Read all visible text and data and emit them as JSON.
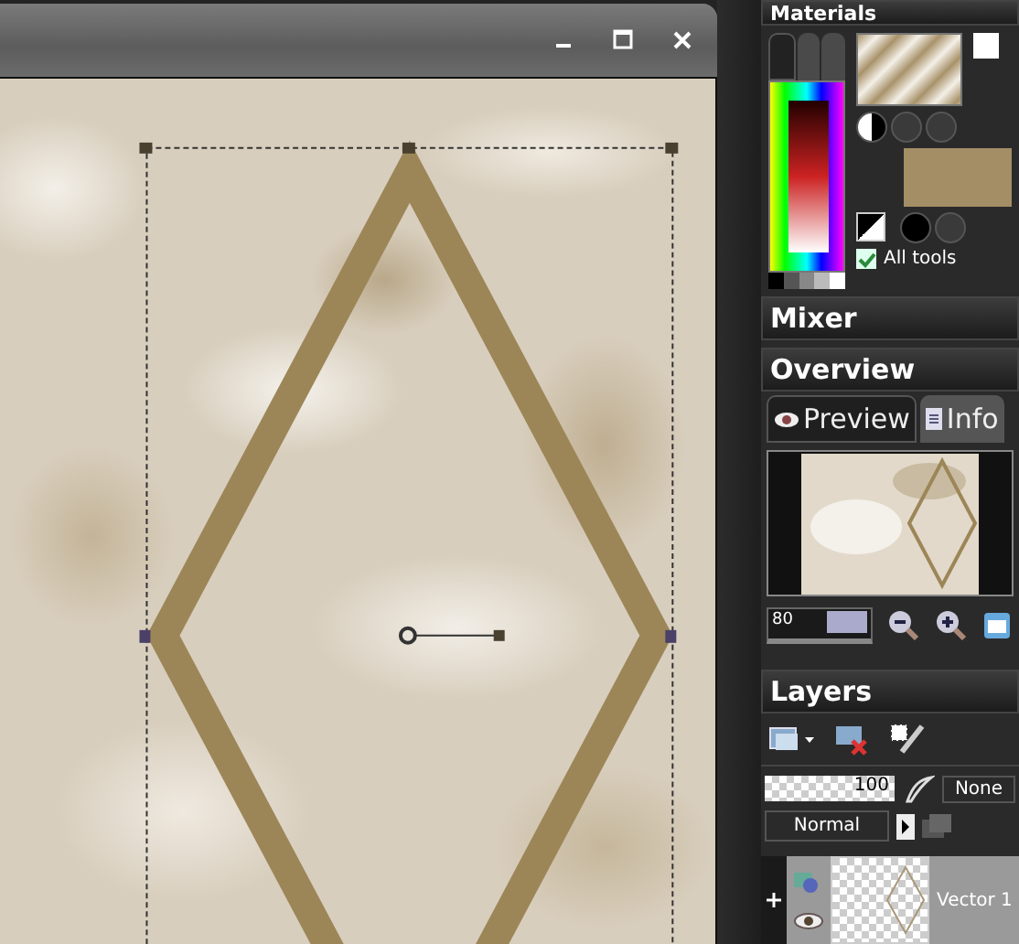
{
  "materials": {
    "title": "Materials",
    "palette_tabs": [
      {
        "selected": true
      },
      {
        "selected": false
      },
      {
        "selected": false
      }
    ],
    "all_tools": {
      "label": "All tools",
      "checked": true
    }
  },
  "mixer": {
    "title": "Mixer"
  },
  "overview": {
    "title": "Overview",
    "tabs": [
      {
        "label": "Preview",
        "selected": true
      },
      {
        "label": "Info",
        "selected": false
      }
    ],
    "zoom": "80"
  },
  "layers": {
    "title": "Layers",
    "opacity": "100",
    "mask": "None",
    "blend_mode": "Normal",
    "items": [
      {
        "name": "Vector 1",
        "visible": true,
        "expanded": false
      }
    ]
  }
}
